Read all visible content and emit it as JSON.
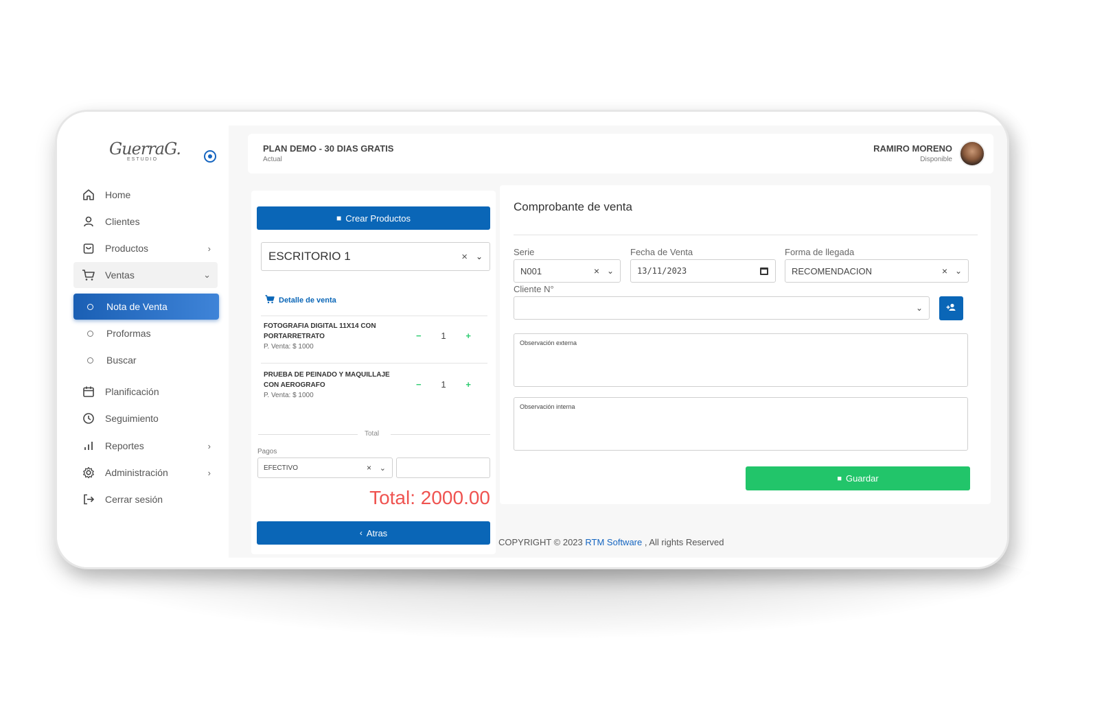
{
  "sidebar": {
    "logo_text": "GuerraG.",
    "logo_sub": "ESTUDIO",
    "items": [
      {
        "label": "Home",
        "icon": "home-icon"
      },
      {
        "label": "Clientes",
        "icon": "user-icon"
      },
      {
        "label": "Productos",
        "icon": "bag-icon"
      },
      {
        "label": "Ventas",
        "icon": "cart-icon"
      },
      {
        "label": "Planificación",
        "icon": "calendar-icon"
      },
      {
        "label": "Seguimiento",
        "icon": "clock-icon"
      },
      {
        "label": "Reportes",
        "icon": "bar-chart-icon"
      },
      {
        "label": "Administración",
        "icon": "gear-icon"
      },
      {
        "label": "Cerrar sesión",
        "icon": "logout-icon"
      }
    ],
    "ventas_sub": [
      {
        "label": "Nota de Venta"
      },
      {
        "label": "Proformas"
      },
      {
        "label": "Buscar"
      }
    ]
  },
  "topbar": {
    "plan_title": "PLAN DEMO - 30 DIAS GRATIS",
    "plan_sub": "Actual",
    "user_name": "RAMIRO MORENO",
    "user_status": "Disponible"
  },
  "left_panel": {
    "create_button": "Crear Productos",
    "location_select": "ESCRITORIO 1",
    "detail_heading": "Detalle de venta",
    "products": [
      {
        "name": "FOTOGRAFIA DIGITAL 11X14 CON PORTARRETRATO",
        "price": "P. Venta: $ 1000",
        "qty": "1"
      },
      {
        "name": "PRUEBA DE PEINADO Y MAQUILLAJE CON AEROGRAFO",
        "price": "P. Venta: $ 1000",
        "qty": "1"
      }
    ],
    "total_separator": "Total",
    "pagos_label": "Pagos",
    "payment_method": "EFECTIVO",
    "payment_amount": "",
    "total_text": "Total: 2000.00",
    "back_button": "Atras"
  },
  "right_panel": {
    "title": "Comprobante de venta",
    "serie_label": "Serie",
    "serie_value": "N001",
    "fecha_label": "Fecha de Venta",
    "fecha_value": "13/11/2023",
    "forma_label": "Forma de llegada",
    "forma_value": "RECOMENDACION",
    "cliente_label": "Cliente N°",
    "cliente_value": "",
    "obs_externa_label": "Observación externa",
    "obs_interna_label": "Observación interna",
    "save_button": "Guardar"
  },
  "footer": {
    "prefix": "COPYRIGHT © 2023 ",
    "link": "RTM Software",
    "suffix": " , All rights Reserved"
  },
  "colors": {
    "primary": "#0a66b7",
    "success": "#22c56a",
    "total_red": "#ef5350"
  }
}
